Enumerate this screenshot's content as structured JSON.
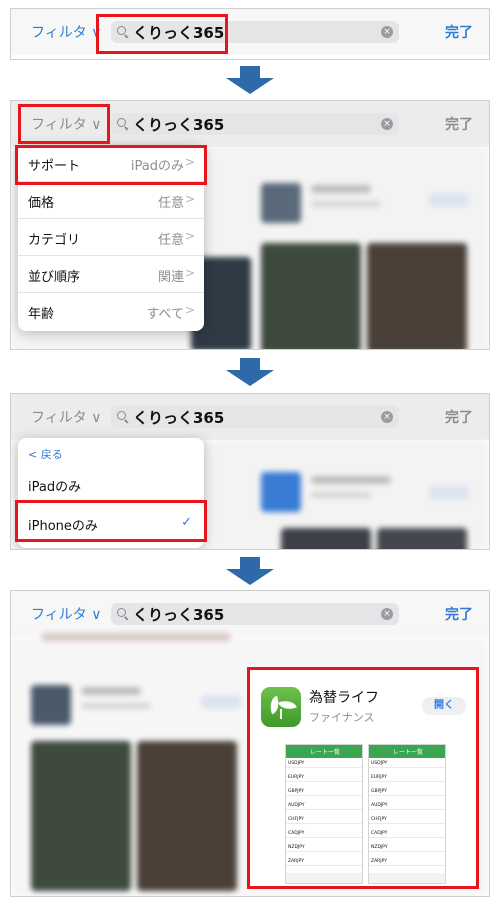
{
  "search_bar": {
    "filter_label": "フィルタ",
    "filter_chevron": "∨",
    "query": "くりっく365",
    "done_label": "完了"
  },
  "filter_menu": {
    "rows": [
      {
        "label": "サポート",
        "value": "iPadのみ"
      },
      {
        "label": "価格",
        "value": "任意"
      },
      {
        "label": "カテゴリ",
        "value": "任意"
      },
      {
        "label": "並び順序",
        "value": "関連"
      },
      {
        "label": "年齢",
        "value": "すべて"
      }
    ]
  },
  "support_menu": {
    "back_label": "戻る",
    "options": [
      "iPadのみ",
      "iPhoneのみ"
    ],
    "checkmark": "✓"
  },
  "result_app": {
    "name": "為替ライフ",
    "category": "ファイナンス",
    "open_label": "開く",
    "screenshot_title": "レート一覧",
    "screenshot_rows": [
      "USDJPY",
      "EURJPY",
      "GBPJPY",
      "AUDJPY",
      "CHFJPY",
      "CADJPY",
      "NZDJPY",
      "ZARJPY"
    ]
  },
  "colors": {
    "accent": "#2f7bd8",
    "highlight": "#e8161c",
    "arrow": "#2e69a9",
    "app_green": "#4caf2f"
  }
}
